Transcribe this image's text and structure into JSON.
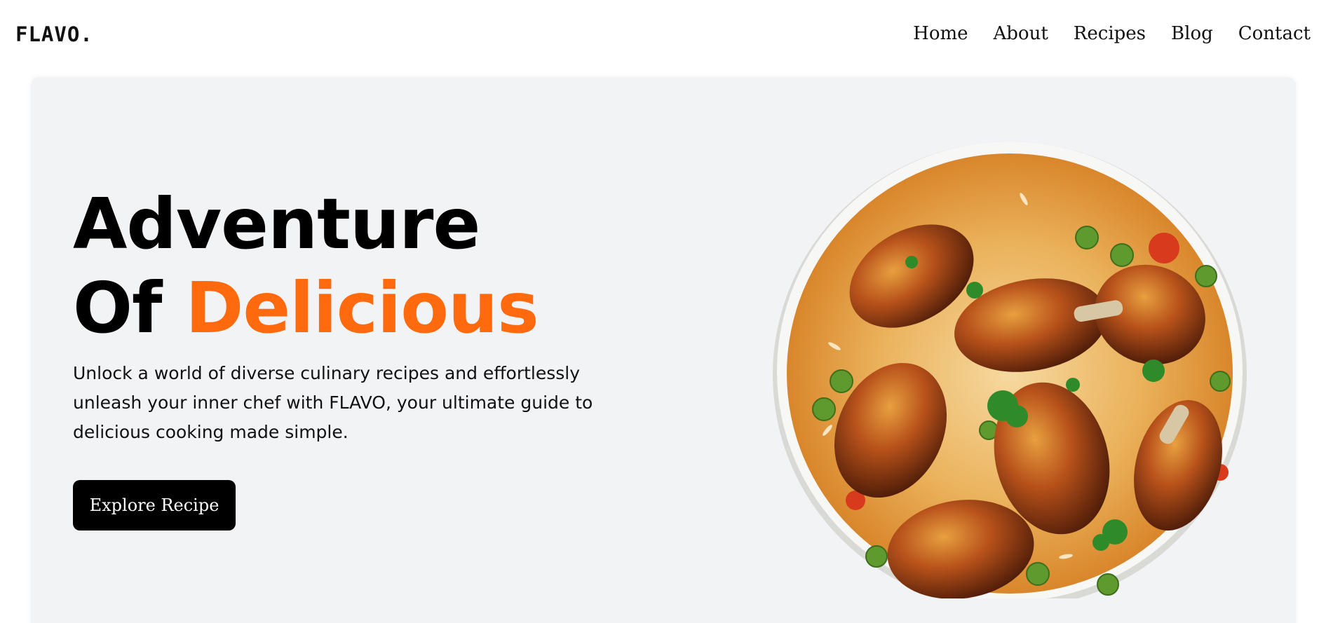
{
  "brand": {
    "logo": "FLAVO."
  },
  "nav": {
    "items": [
      "Home",
      "About",
      "Recipes",
      "Blog",
      "Contact"
    ]
  },
  "hero": {
    "title_line1": "Adventure",
    "title_line2_prefix": "Of",
    "title_line2_accent": "Delicious",
    "description": "Unlock a world of diverse culinary recipes and effortlessly unleash your inner chef with FLAVO, your ultimate guide to delicious cooking made simple.",
    "cta_label": "Explore Recipe"
  },
  "colors": {
    "accent": "#ff6a0f",
    "hero_bg": "#f2f3f5",
    "button_bg": "#000000"
  }
}
